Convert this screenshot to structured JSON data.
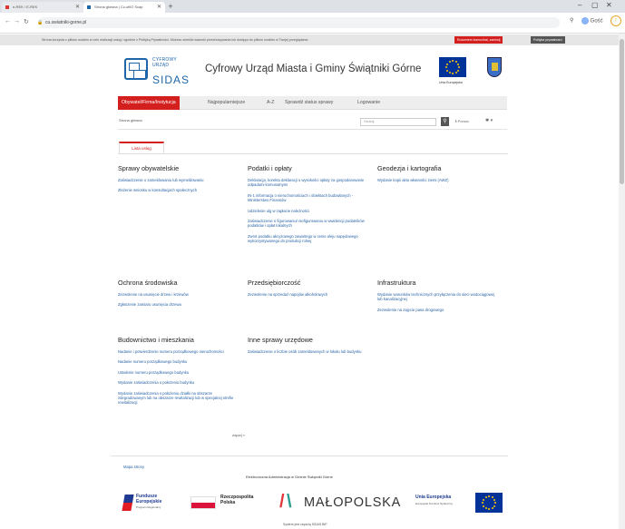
{
  "browser": {
    "tabs": [
      {
        "title": "e-REK / E-REK"
      },
      {
        "title": "Strona główna | Cz-ufilO Scap"
      }
    ],
    "url": "cu.swiatniki-gorne.pl",
    "profile_label": "Gość"
  },
  "cookie_bar": {
    "text": "Strona korzysta z plików cookies w celu realizacji usług i zgodnie z Polityką Prywatności. Możesz określić warunki przechowywania lub dostępu do plików cookies w Twojej przeglądarce.",
    "btn1": "Rozumiem komunikat, zamknij",
    "btn2": "Polityka prywatności",
    "btn1_color": "#d41f1f",
    "btn2_color": "#555555"
  },
  "header": {
    "logo_small": [
      "CYFROWY",
      "URZĄD"
    ],
    "logo_big": "SIDAS",
    "title": "Cyfrowy Urząd Miasta i Gminy Świątniki Górne",
    "eu_caption": "Unia Europejska"
  },
  "nav": {
    "items": [
      "Obywatel/Firma/Instytucja",
      "Najpopularniejsze",
      "A-Z",
      "Sprawdź status sprawy",
      "Logowanie"
    ],
    "accent": "#d41f1f"
  },
  "subbar": {
    "breadcrumb": "Strona główna",
    "search_placeholder": "Szukaj",
    "help_label": "Pomoc"
  },
  "list_tab": "Lista usług",
  "categories": [
    {
      "title": "Sprawy obywatelskie",
      "links": [
        "Zaświadczenie o zameldowaniu lub wymeldowaniu",
        "Złożenie wniosku w konsultacjach społecznych"
      ]
    },
    {
      "title": "Podatki i opłaty",
      "links": [
        "Deklaracja, korekta deklaracji o wysokości opłaty za gospodarowanie odpadami komunalnymi",
        "IN-1 informacja o nieruchomościach i obiektach budowlanych - Ministerstwo Finansów",
        "Udzielenie ulg w zapłacie należności",
        "Zaświadczenie o figurowaniu/ niefigurowaniu w wwidencji podatników podatków i opłat lokalnych",
        "Zwrot podatku akcyzowego zawartego w cenie oleju napędowego wykorzystywanego do produkcji rolnej"
      ]
    },
    {
      "title": "Geodezja i kartografia",
      "links": [
        "Wydanie kopii aktu własności ziemi (AWZ)"
      ]
    },
    {
      "title": "Ochrona środowiska",
      "links": [
        "Zezwolenie na usunięcie drzew i krzewów",
        "Zgłoszenie zamiaru usunięcia drzewa"
      ]
    },
    {
      "title": "Przedsiębiorczość",
      "links": [
        "Zezwolenie na sprzedaż napojów alkoholowych"
      ]
    },
    {
      "title": "Infrastruktura",
      "links": [
        "Wydanie warunków technicznych przyłączenia do sieci wodociągowej lub kanalizacyjnej",
        "Zezwolenie na zajęcie pasa drogowego"
      ]
    },
    {
      "title": "Budownictwo i mieszkania",
      "links": [
        "Nadanie i potwierdzenie numeru porządkowego nieruchomości",
        "Nadanie numeru porządkowego budynku",
        "Ustalenie numeru porządkowego budynku",
        "Wydanie zaświadczenia o położeniu budynku",
        "Wydanie zaświadczenia o położeniu działki na obszarze zdegradowanym lub na obszarze rewitalizacji lub w specjalnej strefie rewitalizacji"
      ]
    },
    {
      "title": "Inne sprawy urzędowe",
      "links": [
        "Zaświadczenie o liczbie osób zameldowanych w lokalu lub budynku"
      ]
    }
  ],
  "more_label": "więcej »",
  "footer": {
    "map_link": "Mapa strony",
    "title": "Elektroniczna Administracja w Gminie Świątniki Górne",
    "fe_title": [
      "Fundusze",
      "Europejskie"
    ],
    "fe_sub": "Program Regionalny",
    "rp_title": [
      "Rzeczpospolita",
      "Polska"
    ],
    "mp_title": "MAŁOPOLSKA",
    "ue_title": "Unia Europejska",
    "ue_sub": "Europejski Fundusz Społeczny",
    "note": "System jest częścią SIDAS BiP"
  }
}
